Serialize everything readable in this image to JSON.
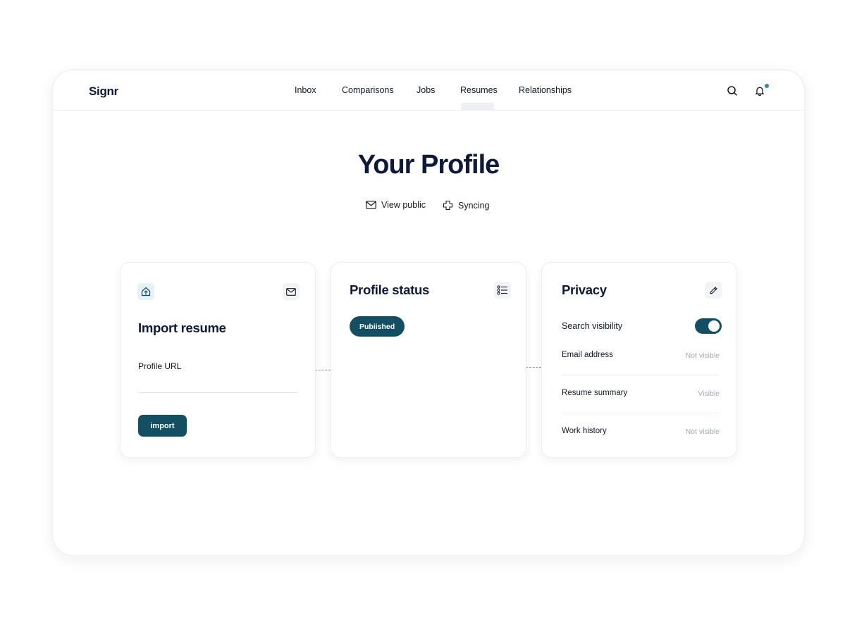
{
  "brand": "Signr",
  "nav": {
    "items": [
      {
        "label": "Inbox"
      },
      {
        "label": "Comparisons"
      },
      {
        "label": "Jobs"
      },
      {
        "label": "Resumes"
      },
      {
        "label": "Relationships"
      }
    ],
    "active": "Resumes"
  },
  "header_icons": [
    "search-icon",
    "bell-icon"
  ],
  "page": {
    "title": "Your Profile",
    "actions": [
      {
        "label": "View public",
        "icon": "mail-icon"
      },
      {
        "label": "Syncing",
        "icon": "puzzle-icon"
      }
    ]
  },
  "import_card": {
    "title": "Import resume",
    "field_label": "Profile URL",
    "field_value": "",
    "button_label": "import",
    "icons": [
      "upload-icon",
      "mail-icon"
    ]
  },
  "status_card": {
    "title": "Profile status",
    "status": "Pubiished",
    "icon": "checklist-icon"
  },
  "privacy_card": {
    "title": "Privacy",
    "icon": "pencil-icon",
    "search_visibility_label": "Search visibility",
    "search_visibility_on": true,
    "rows": [
      {
        "label": "Email address",
        "value": "Not visible"
      },
      {
        "label": "Resume summary",
        "value": "Visible"
      },
      {
        "label": "Work history",
        "value": "Not visible"
      }
    ]
  },
  "colors": {
    "primary": "#134f63",
    "text": "#0e1a3a",
    "muted": "#a3a8b0",
    "notification": "#2f8bb3",
    "upload_icon_bg": "#e6f3f6"
  }
}
